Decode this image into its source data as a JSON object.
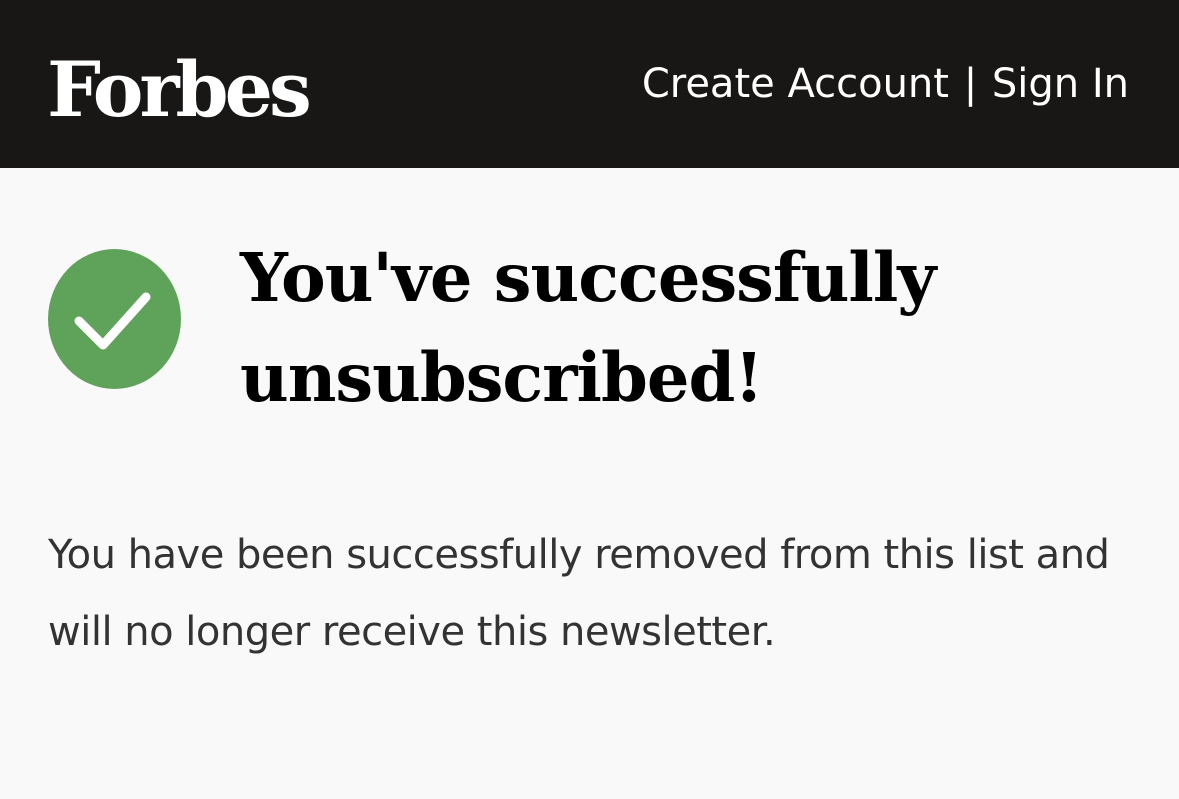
{
  "header": {
    "logo_text": "Forbes",
    "create_account_label": "Create Account",
    "separator": "|",
    "sign_in_label": "Sign In"
  },
  "status": {
    "icon": "check-circle-icon",
    "icon_color": "#5fa35a",
    "headline": "You've successfully unsubscribed!"
  },
  "body": {
    "message": "You have been successfully removed from this list and will no longer receive this newsletter."
  },
  "colors": {
    "header_bg": "#181716",
    "page_bg": "#f9f9f9"
  }
}
